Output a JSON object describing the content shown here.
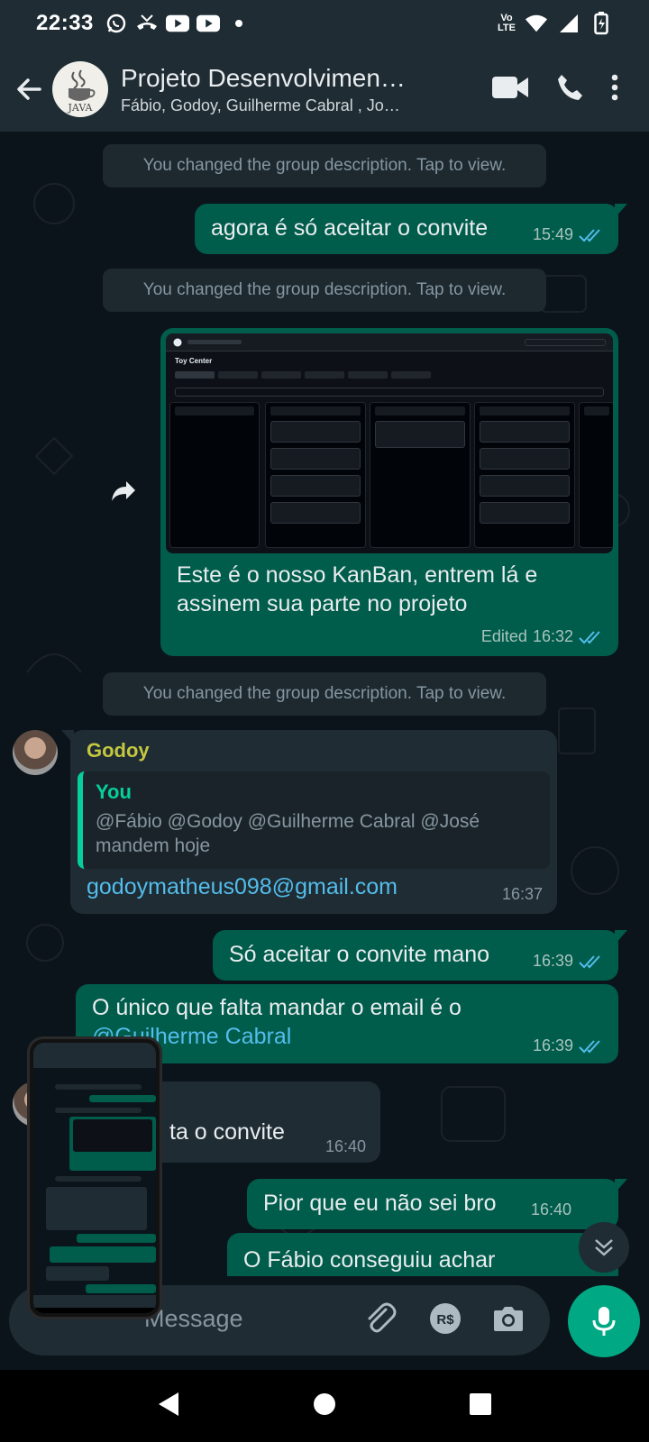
{
  "status_bar": {
    "time": "22:33",
    "network_line1": "Vo",
    "network_line2": "LTE"
  },
  "header": {
    "title": "Projeto Desenvolvimen…",
    "subtitle": "Fábio, Godoy, Guilherme Cabral , Jo…",
    "avatar_text": "JAVA"
  },
  "messages": {
    "sys1": "You changed the group description. Tap to view.",
    "out1_text": "agora é só aceitar o convite",
    "out1_time": "15:49",
    "sys2": "You changed the group description. Tap to view.",
    "img_caption": "Este é o nosso KanBan, entrem lá e assinem sua parte no projeto",
    "img_edited": "Edited",
    "img_time": "16:32",
    "img_title": "Toy Center",
    "sys3": "You changed the group description. Tap to view.",
    "in1_sender": "Godoy",
    "in1_quote_author": "You",
    "in1_quote_text": "@Fábio @Godoy @Guilherme Cabral @José mandem hoje",
    "in1_text": "godoymatheus098@gmail.com",
    "in1_time": "16:37",
    "out2_text": "Só aceitar o convite mano",
    "out2_time": "16:39",
    "out3_text": "O único que falta mandar o email é o",
    "out3_mention": "@Guilherme Cabral",
    "out3_time": "16:39",
    "in2_text": "ta o convite",
    "in2_time": "16:40",
    "out4_text": "Pior que eu não sei bro",
    "out4_time": "16:40",
    "out5_partial": "O Fábio conseguiu achar"
  },
  "input": {
    "placeholder": "Message"
  },
  "colors": {
    "outgoing": "#005c4b",
    "incoming": "#1f2c34",
    "accent": "#00a884",
    "read_ticks": "#53bdeb"
  }
}
